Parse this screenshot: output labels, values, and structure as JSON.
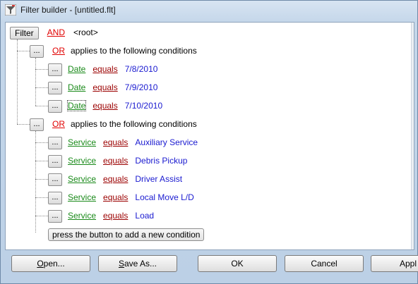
{
  "window": {
    "title": "Filter builder - [untitled.flt]"
  },
  "root": {
    "filter_label": "Filter",
    "operator": "AND",
    "label": "<root>"
  },
  "groups": [
    {
      "operator": "OR",
      "text": "applies to the following conditions",
      "button": "...",
      "conditions": [
        {
          "button": "...",
          "field": "Date",
          "op": "equals",
          "value": "7/8/2010"
        },
        {
          "button": "...",
          "field": "Date",
          "op": "equals",
          "value": "7/9/2010"
        },
        {
          "button": "...",
          "field": "Date",
          "op": "equals",
          "value": "7/10/2010"
        }
      ]
    },
    {
      "operator": "OR",
      "text": "applies to the following conditions",
      "button": "...",
      "conditions": [
        {
          "button": "...",
          "field": "Service",
          "op": "equals",
          "value": "Auxiliary Service"
        },
        {
          "button": "...",
          "field": "Service",
          "op": "equals",
          "value": "Debris Pickup"
        },
        {
          "button": "...",
          "field": "Service",
          "op": "equals",
          "value": "Driver Assist"
        },
        {
          "button": "...",
          "field": "Service",
          "op": "equals",
          "value": "Local Move L/D"
        },
        {
          "button": "...",
          "field": "Service",
          "op": "equals",
          "value": "Load"
        }
      ]
    }
  ],
  "add_condition_label": "press the button to add a new condition",
  "buttons": {
    "open_first": "O",
    "open_rest": "pen...",
    "saveas_first": "S",
    "saveas_rest": "ave As...",
    "ok": "OK",
    "cancel": "Cancel",
    "apply": "Appl"
  }
}
